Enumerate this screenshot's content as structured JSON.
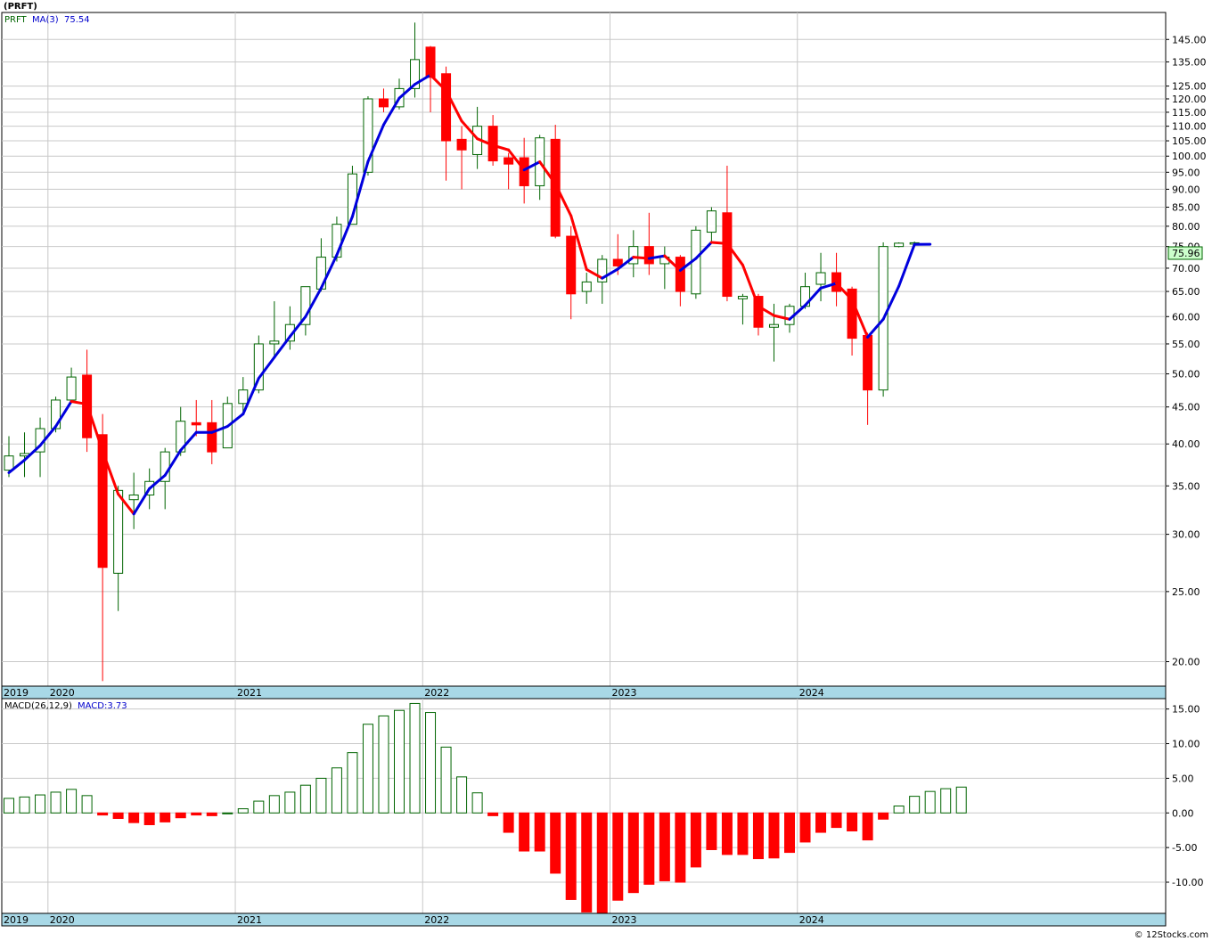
{
  "header": {
    "symbol_title": "(PRFT)",
    "ticker": "PRFT",
    "ma_label": "MA(3)",
    "ma_value": "75.54",
    "macd_label": "MACD(26,12,9)",
    "macd_value_label": "MACD:3.73",
    "last_price": "75.96",
    "watermark": "© 12Stocks.com"
  },
  "colors": {
    "up_candle": "#006400",
    "down_candle": "#ff0000",
    "ma_up": "#0000dd",
    "ma_down": "#ff0000",
    "grid": "#c8c8c8",
    "axis_band": "#a8d8e6",
    "price_tag_bg": "#ccffcc"
  },
  "year_labels": [
    "2019",
    "2020",
    "2021",
    "2022",
    "2023",
    "2024"
  ],
  "chart_data": [
    {
      "type": "candlestick",
      "title": "(PRFT)",
      "y_scale": "log",
      "ylim": [
        18.5,
        158
      ],
      "y_ticks": [
        20,
        25,
        30,
        35,
        40,
        45,
        50,
        55,
        60,
        65,
        70,
        75,
        80,
        85,
        90,
        95,
        100,
        105,
        110,
        115,
        120,
        125,
        135,
        145
      ],
      "y_tick_labels": [
        "20.00",
        "25.00",
        "30.00",
        "35.00",
        "40.00",
        "45.00",
        "50.00",
        "55.00",
        "60.00",
        "65.00",
        "70.00",
        "75.00",
        "80.00",
        "85.00",
        "90.00",
        "95.00",
        "100.00",
        "105.00",
        "110.00",
        "115.00",
        "120.00",
        "125.00",
        "135.00",
        "145.00"
      ],
      "grid": true,
      "last_value": 75.96,
      "ma_period": 3,
      "ma_last": 75.54,
      "candles": [
        {
          "date": "2019-10",
          "o": 36.8,
          "h": 41.0,
          "l": 36.0,
          "c": 38.5
        },
        {
          "date": "2019-11",
          "o": 38.5,
          "h": 41.5,
          "l": 36.0,
          "c": 38.8
        },
        {
          "date": "2019-12",
          "o": 39.0,
          "h": 43.5,
          "l": 36.0,
          "c": 42.0
        },
        {
          "date": "2020-01",
          "o": 42.0,
          "h": 46.5,
          "l": 41.5,
          "c": 46.0
        },
        {
          "date": "2020-02",
          "o": 46.0,
          "h": 51.0,
          "l": 45.5,
          "c": 49.5
        },
        {
          "date": "2020-03",
          "o": 49.8,
          "h": 54.0,
          "l": 39.0,
          "c": 40.8
        },
        {
          "date": "2020-04",
          "o": 41.2,
          "h": 44.0,
          "l": 18.8,
          "c": 27.0
        },
        {
          "date": "2020-05",
          "o": 26.5,
          "h": 35.0,
          "l": 23.5,
          "c": 34.5
        },
        {
          "date": "2020-06",
          "o": 33.5,
          "h": 36.5,
          "l": 30.5,
          "c": 34.0
        },
        {
          "date": "2020-07",
          "o": 34.0,
          "h": 37.0,
          "l": 32.5,
          "c": 35.5
        },
        {
          "date": "2020-08",
          "o": 35.5,
          "h": 39.5,
          "l": 32.5,
          "c": 39.0
        },
        {
          "date": "2020-09",
          "o": 39.0,
          "h": 45.0,
          "l": 38.5,
          "c": 43.0
        },
        {
          "date": "2020-10",
          "o": 42.8,
          "h": 46.0,
          "l": 41.0,
          "c": 42.5
        },
        {
          "date": "2020-11",
          "o": 42.8,
          "h": 46.0,
          "l": 37.5,
          "c": 39.0
        },
        {
          "date": "2020-12",
          "o": 39.5,
          "h": 46.5,
          "l": 39.5,
          "c": 45.5
        },
        {
          "date": "2021-01",
          "o": 45.5,
          "h": 49.5,
          "l": 44.0,
          "c": 47.5
        },
        {
          "date": "2021-02",
          "o": 47.5,
          "h": 56.5,
          "l": 47.0,
          "c": 55.0
        },
        {
          "date": "2021-03",
          "o": 55.0,
          "h": 63.0,
          "l": 52.5,
          "c": 55.5
        },
        {
          "date": "2021-04",
          "o": 55.5,
          "h": 62.0,
          "l": 54.0,
          "c": 58.5
        },
        {
          "date": "2021-05",
          "o": 58.5,
          "h": 66.0,
          "l": 56.5,
          "c": 66.0
        },
        {
          "date": "2021-06",
          "o": 65.5,
          "h": 77.0,
          "l": 65.0,
          "c": 72.5
        },
        {
          "date": "2021-07",
          "o": 72.5,
          "h": 82.5,
          "l": 71.5,
          "c": 80.5
        },
        {
          "date": "2021-08",
          "o": 80.5,
          "h": 97.0,
          "l": 80.5,
          "c": 94.5
        },
        {
          "date": "2021-09",
          "o": 95.0,
          "h": 121.0,
          "l": 94.0,
          "c": 120.0
        },
        {
          "date": "2021-10",
          "o": 120.0,
          "h": 124.0,
          "l": 115.0,
          "c": 117.0
        },
        {
          "date": "2021-11",
          "o": 117.0,
          "h": 128.0,
          "l": 116.0,
          "c": 124.0
        },
        {
          "date": "2021-12",
          "o": 124.0,
          "h": 153.0,
          "l": 120.5,
          "c": 136.0
        },
        {
          "date": "2022-01",
          "o": 141.5,
          "h": 142.0,
          "l": 115.0,
          "c": 128.5
        },
        {
          "date": "2022-02",
          "o": 130.0,
          "h": 133.0,
          "l": 92.5,
          "c": 105.0
        },
        {
          "date": "2022-03",
          "o": 105.5,
          "h": 110.0,
          "l": 90.0,
          "c": 102.0
        },
        {
          "date": "2022-04",
          "o": 100.5,
          "h": 117.0,
          "l": 96.0,
          "c": 110.0
        },
        {
          "date": "2022-05",
          "o": 110.0,
          "h": 114.0,
          "l": 97.0,
          "c": 98.5
        },
        {
          "date": "2022-06",
          "o": 99.5,
          "h": 101.0,
          "l": 90.0,
          "c": 97.5
        },
        {
          "date": "2022-07",
          "o": 99.5,
          "h": 106.0,
          "l": 86.0,
          "c": 91.0
        },
        {
          "date": "2022-08",
          "o": 91.0,
          "h": 107.0,
          "l": 87.0,
          "c": 106.0
        },
        {
          "date": "2022-09",
          "o": 105.5,
          "h": 110.5,
          "l": 77.0,
          "c": 77.5
        },
        {
          "date": "2022-10",
          "o": 77.5,
          "h": 80.0,
          "l": 59.5,
          "c": 64.5
        },
        {
          "date": "2022-11",
          "o": 65.0,
          "h": 69.0,
          "l": 62.5,
          "c": 67.0
        },
        {
          "date": "2022-12",
          "o": 67.0,
          "h": 73.0,
          "l": 62.5,
          "c": 72.0
        },
        {
          "date": "2023-01",
          "o": 72.0,
          "h": 78.0,
          "l": 68.5,
          "c": 70.5
        },
        {
          "date": "2023-02",
          "o": 71.0,
          "h": 79.0,
          "l": 68.0,
          "c": 75.0
        },
        {
          "date": "2023-03",
          "o": 75.0,
          "h": 83.5,
          "l": 68.5,
          "c": 71.0
        },
        {
          "date": "2023-04",
          "o": 71.0,
          "h": 75.0,
          "l": 65.5,
          "c": 72.5
        },
        {
          "date": "2023-05",
          "o": 72.5,
          "h": 73.0,
          "l": 62.0,
          "c": 65.0
        },
        {
          "date": "2023-06",
          "o": 64.5,
          "h": 80.0,
          "l": 63.5,
          "c": 79.0
        },
        {
          "date": "2023-07",
          "o": 78.5,
          "h": 85.0,
          "l": 76.0,
          "c": 84.0
        },
        {
          "date": "2023-08",
          "o": 83.5,
          "h": 97.0,
          "l": 63.0,
          "c": 64.0
        },
        {
          "date": "2023-09",
          "o": 63.5,
          "h": 64.5,
          "l": 58.5,
          "c": 64.0
        },
        {
          "date": "2023-10",
          "o": 64.0,
          "h": 64.5,
          "l": 56.5,
          "c": 58.0
        },
        {
          "date": "2023-11",
          "o": 58.0,
          "h": 62.5,
          "l": 52.0,
          "c": 58.5
        },
        {
          "date": "2023-12",
          "o": 58.5,
          "h": 62.5,
          "l": 57.0,
          "c": 62.0
        },
        {
          "date": "2024-01",
          "o": 62.0,
          "h": 69.0,
          "l": 61.5,
          "c": 66.0
        },
        {
          "date": "2024-02",
          "o": 66.5,
          "h": 73.5,
          "l": 63.0,
          "c": 69.0
        },
        {
          "date": "2024-03",
          "o": 69.0,
          "h": 73.5,
          "l": 62.0,
          "c": 65.0
        },
        {
          "date": "2024-04",
          "o": 65.5,
          "h": 66.0,
          "l": 53.0,
          "c": 56.0
        },
        {
          "date": "2024-05",
          "o": 56.5,
          "h": 57.0,
          "l": 42.5,
          "c": 47.5
        },
        {
          "date": "2024-06",
          "o": 47.5,
          "h": 76.0,
          "l": 46.5,
          "c": 75.0
        },
        {
          "date": "2024-07",
          "o": 75.0,
          "h": 76.0,
          "l": 74.8,
          "c": 75.8
        },
        {
          "date": "2024-08",
          "o": 75.8,
          "h": 76.2,
          "l": 75.5,
          "c": 75.9
        }
      ],
      "ma3": [
        36.5,
        38.0,
        39.8,
        42.3,
        45.8,
        45.4,
        39.1,
        34.1,
        32.0,
        34.7,
        36.2,
        39.2,
        41.5,
        41.5,
        42.3,
        44.0,
        49.3,
        52.7,
        56.3,
        60.0,
        65.7,
        73.0,
        82.5,
        98.3,
        110.5,
        120.3,
        125.7,
        129.5,
        123.2,
        111.8,
        105.7,
        103.5,
        102.0,
        95.7,
        98.2,
        91.5,
        82.7,
        69.7,
        67.8,
        69.8,
        72.5,
        72.2,
        72.8,
        69.5,
        72.2,
        76.0,
        75.7,
        70.7,
        62.0,
        60.2,
        59.5,
        62.2,
        65.7,
        66.7,
        63.3,
        56.2,
        59.5,
        66.1,
        75.5,
        75.54
      ]
    },
    {
      "type": "bar",
      "title": "MACD(26,12,9)",
      "value_label": "MACD:3.73",
      "ylim": [
        -14.5,
        16.5
      ],
      "y_ticks": [
        -10,
        -5,
        0,
        5,
        10,
        15
      ],
      "y_tick_labels": [
        "-10.00",
        "-5.00",
        "0.00",
        "5.00",
        "10.00",
        "15.00"
      ],
      "grid": true,
      "values": [
        2.1,
        2.3,
        2.6,
        3.0,
        3.4,
        2.5,
        -0.3,
        -0.8,
        -1.4,
        -1.7,
        -1.3,
        -0.7,
        -0.3,
        -0.4,
        0.0,
        0.6,
        1.7,
        2.5,
        3.0,
        4.0,
        5.0,
        6.5,
        8.7,
        12.8,
        14.0,
        14.8,
        15.8,
        14.5,
        9.5,
        5.2,
        2.9,
        -0.4,
        -2.8,
        -5.5,
        -5.5,
        -8.7,
        -12.5,
        -14.3,
        -14.4,
        -12.6,
        -11.5,
        -10.3,
        -9.8,
        -10.0,
        -7.8,
        -5.3,
        -6.0,
        -6.0,
        -6.6,
        -6.5,
        -5.7,
        -4.2,
        -2.8,
        -2.1,
        -2.6,
        -3.9,
        -0.9,
        1.0,
        2.4,
        3.1,
        3.5,
        3.73
      ]
    }
  ]
}
